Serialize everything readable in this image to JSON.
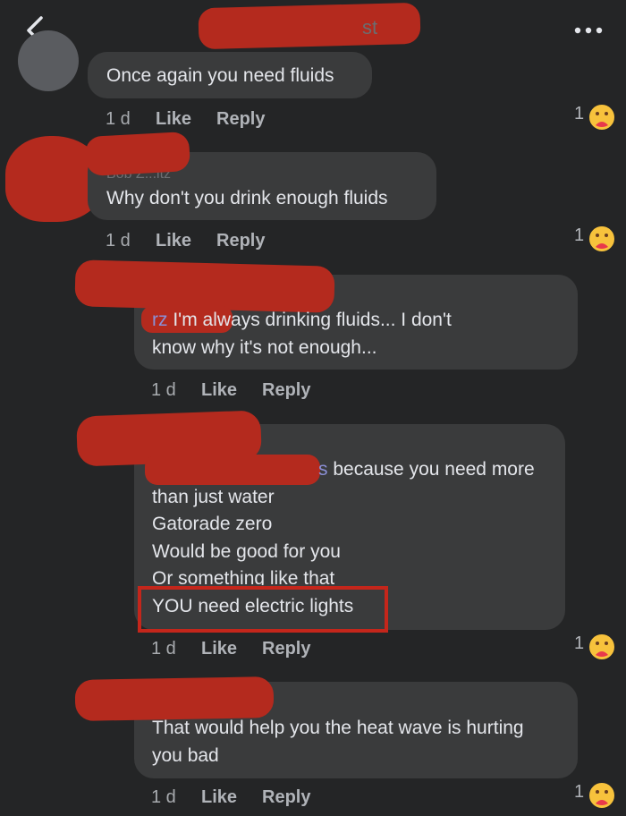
{
  "header": {
    "title_peek": "st"
  },
  "comments": [
    {
      "text_lines": [
        "Once again you need fluids"
      ],
      "time": "1 d",
      "like": "Like",
      "reply": "Reply",
      "reaction_count": "1"
    },
    {
      "author_partial": "Bob Z...itz",
      "text_lines": [
        "Why don't you drink enough fluids"
      ],
      "time": "1 d",
      "like": "Like",
      "reply": "Reply",
      "reaction_count": "1"
    },
    {
      "mention_partial": "rz",
      "text_lines": [
        "I'm always drinking fluids... I don't",
        "know why it's not enough..."
      ],
      "time": "1 d",
      "like": "Like",
      "reply": "Reply"
    },
    {
      "mention_partial": "s",
      "text_lines": [
        "because you need more",
        "than just water",
        "Gatorade zero",
        "Would be good for you",
        "Or something like that",
        "YOU need electric lights"
      ],
      "time": "1 d",
      "like": "Like",
      "reply": "Reply",
      "reaction_count": "1"
    },
    {
      "text_lines": [
        "That would help you the heat wave is hurting",
        "you bad"
      ],
      "time": "1 d",
      "like": "Like",
      "reply": "Reply",
      "reaction_count": "1"
    }
  ],
  "colors": {
    "background": "#242526",
    "bubble": "#3a3b3c",
    "redaction": "#b42a1e",
    "highlight": "#c4261b"
  },
  "icons": {
    "back": "chevron-left-icon",
    "more": "more-dots-icon",
    "reaction": "care-emoji-icon"
  }
}
